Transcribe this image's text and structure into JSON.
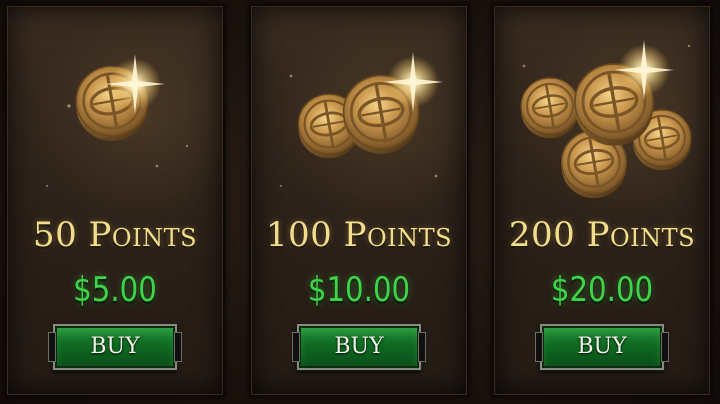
{
  "store": {
    "packs": [
      {
        "points_label": "50 Points",
        "price": "$5.00",
        "buy_label": "BUY",
        "coin_icon": "gold-coin-icon"
      },
      {
        "points_label": "100 Points",
        "price": "$10.00",
        "buy_label": "BUY",
        "coin_icon": "gold-coin-stack-icon"
      },
      {
        "points_label": "200 Points",
        "price": "$20.00",
        "buy_label": "BUY",
        "coin_icon": "gold-coin-pile-icon"
      }
    ]
  },
  "colors": {
    "gold_text": "#f1dd8c",
    "price_green": "#3fd34a",
    "button_green": "#0f6a22",
    "panel_brown": "#2c2119"
  }
}
